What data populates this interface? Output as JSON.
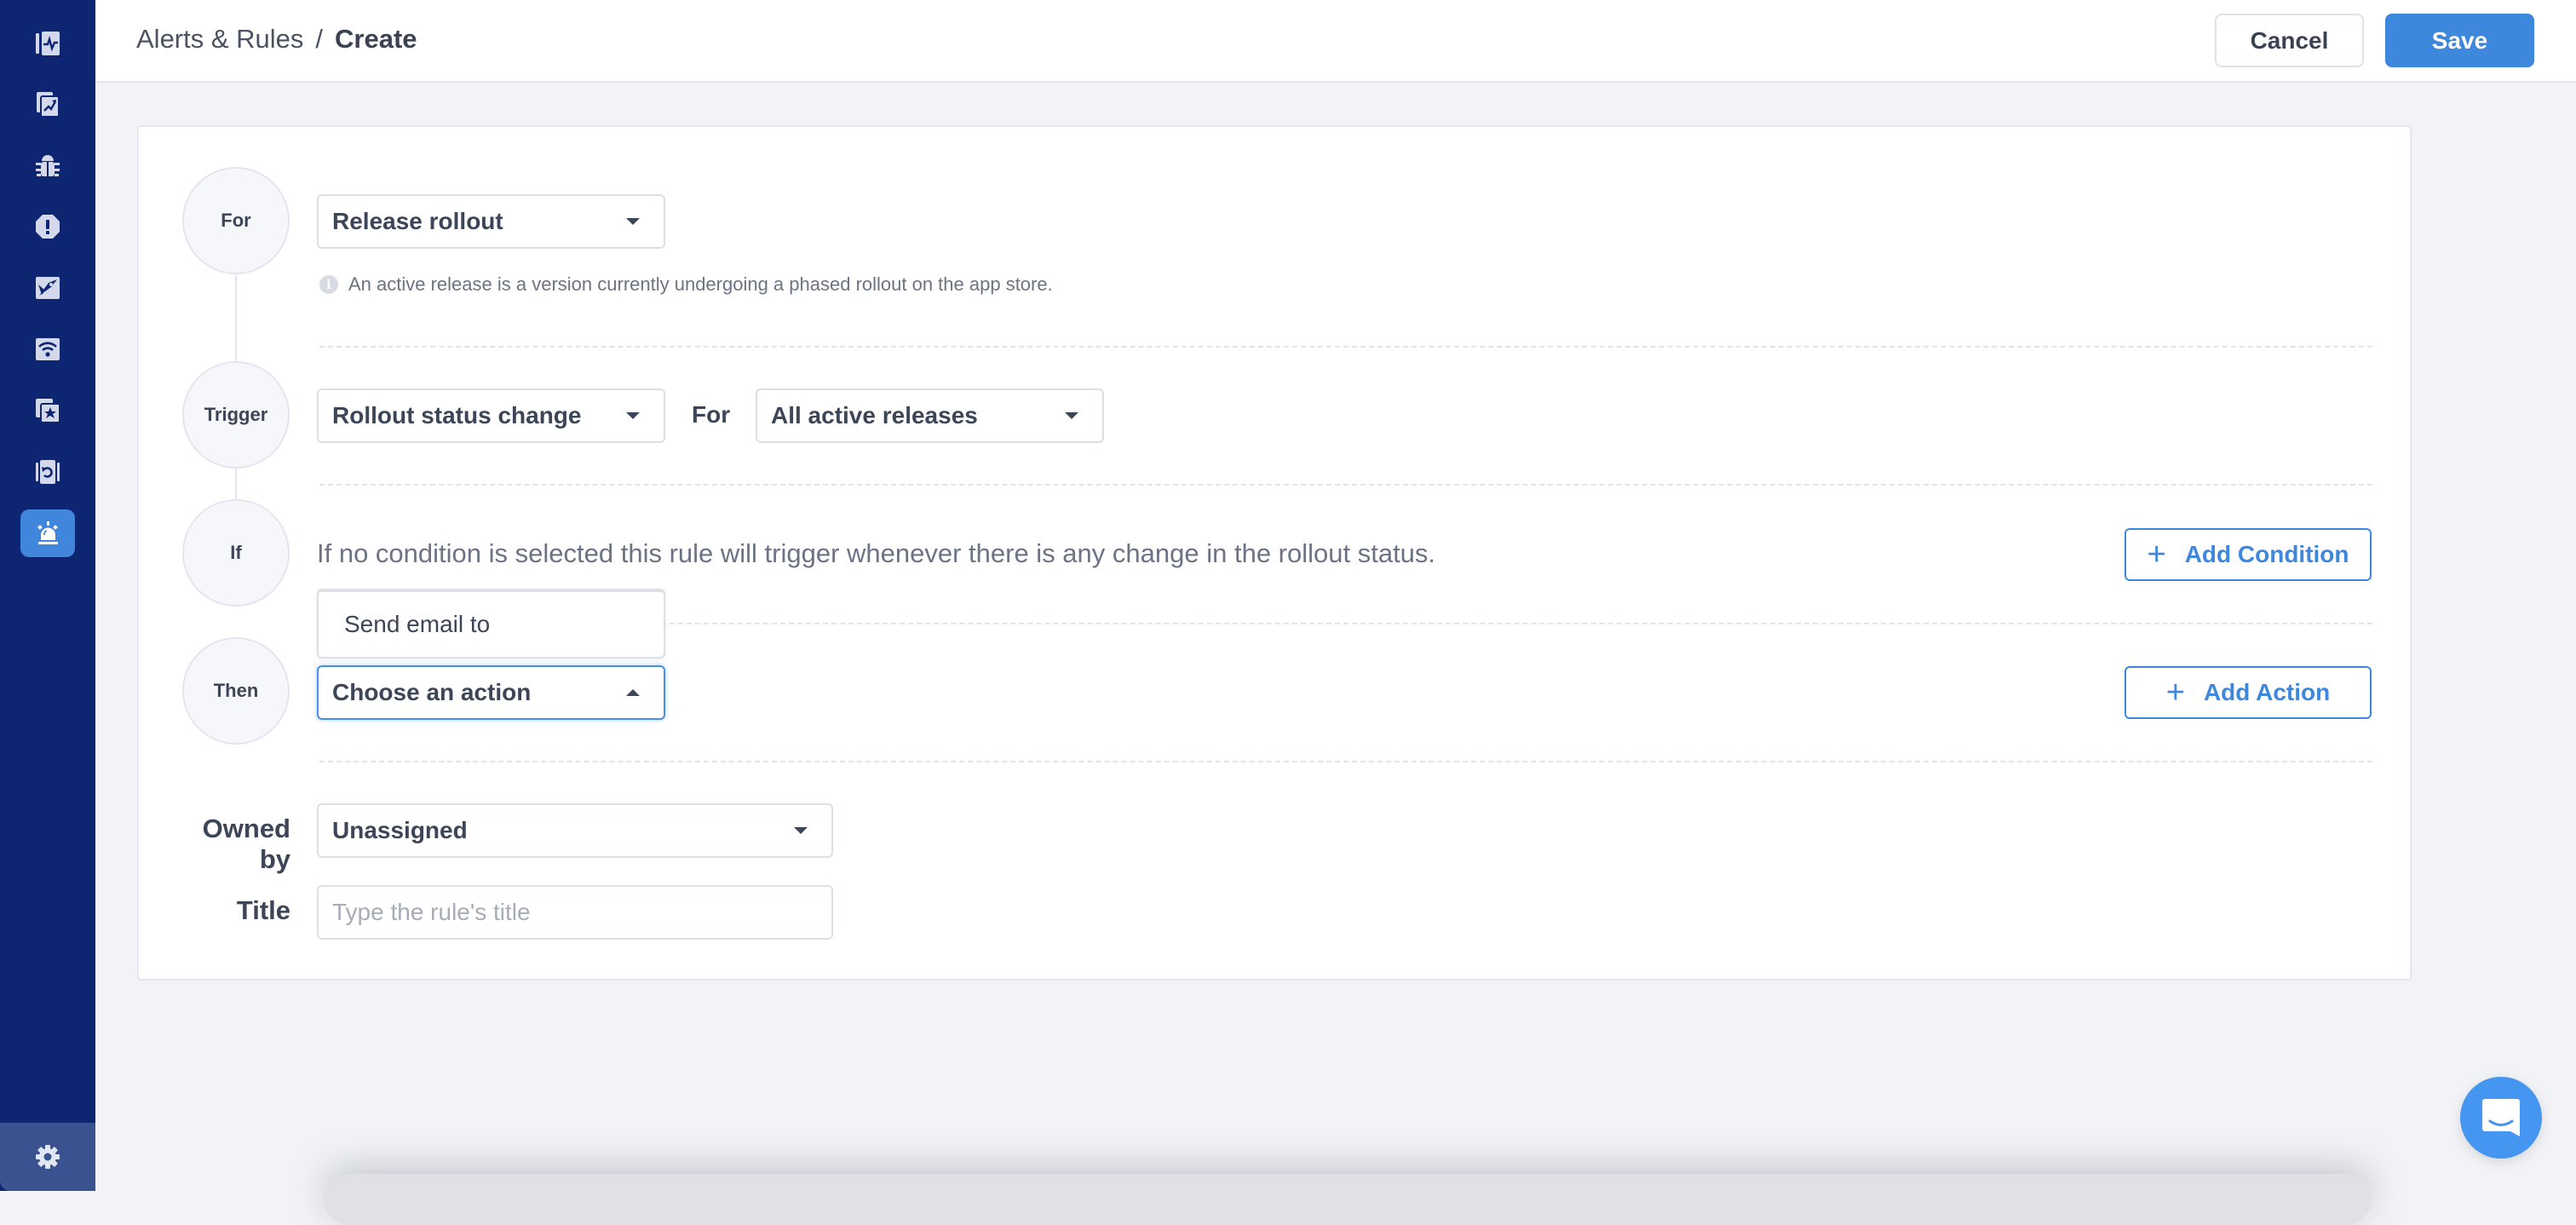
{
  "sidebar": {
    "items": [
      {
        "icon": "app-health-icon",
        "active": false
      },
      {
        "icon": "trends-icon",
        "active": false
      },
      {
        "icon": "bug-icon",
        "active": false
      },
      {
        "icon": "crash-alert-icon",
        "active": false
      },
      {
        "icon": "launch-icon",
        "active": false
      },
      {
        "icon": "network-icon",
        "active": false
      },
      {
        "icon": "reviews-icon",
        "active": false
      },
      {
        "icon": "release-icon",
        "active": false
      },
      {
        "icon": "alarm-icon",
        "active": true
      }
    ],
    "footer_icon": "gear-icon"
  },
  "header": {
    "breadcrumb": {
      "parent": "Alerts & Rules",
      "separator": "/",
      "current": "Create"
    },
    "cancel_label": "Cancel",
    "save_label": "Save"
  },
  "colors": {
    "sidebar_bg": "#0e2672",
    "accent": "#3d87dc",
    "page_bg": "#f1f3f7"
  },
  "rule": {
    "for": {
      "node_label": "For",
      "select_value": "Release rollout",
      "info_text": "An active release is a version currently undergoing a phased rollout on the app store."
    },
    "trigger": {
      "node_label": "Trigger",
      "select_value": "Rollout status change",
      "for_label": "For",
      "scope_value": "All active releases"
    },
    "if": {
      "node_label": "If",
      "hint": "If no condition is selected this rule will trigger whenever there is any change in the rollout status.",
      "add_button": "Add Condition"
    },
    "then": {
      "node_label": "Then",
      "select_value": "Choose an action",
      "dropdown_open": true,
      "options": [
        "Send email to"
      ],
      "add_button": "Add Action"
    }
  },
  "meta_fields": {
    "owned_by_label": "Owned by",
    "owned_by_value": "Unassigned",
    "title_label": "Title",
    "title_value": "",
    "title_placeholder": "Type the rule's title"
  },
  "chat": {
    "icon": "chat-icon"
  }
}
